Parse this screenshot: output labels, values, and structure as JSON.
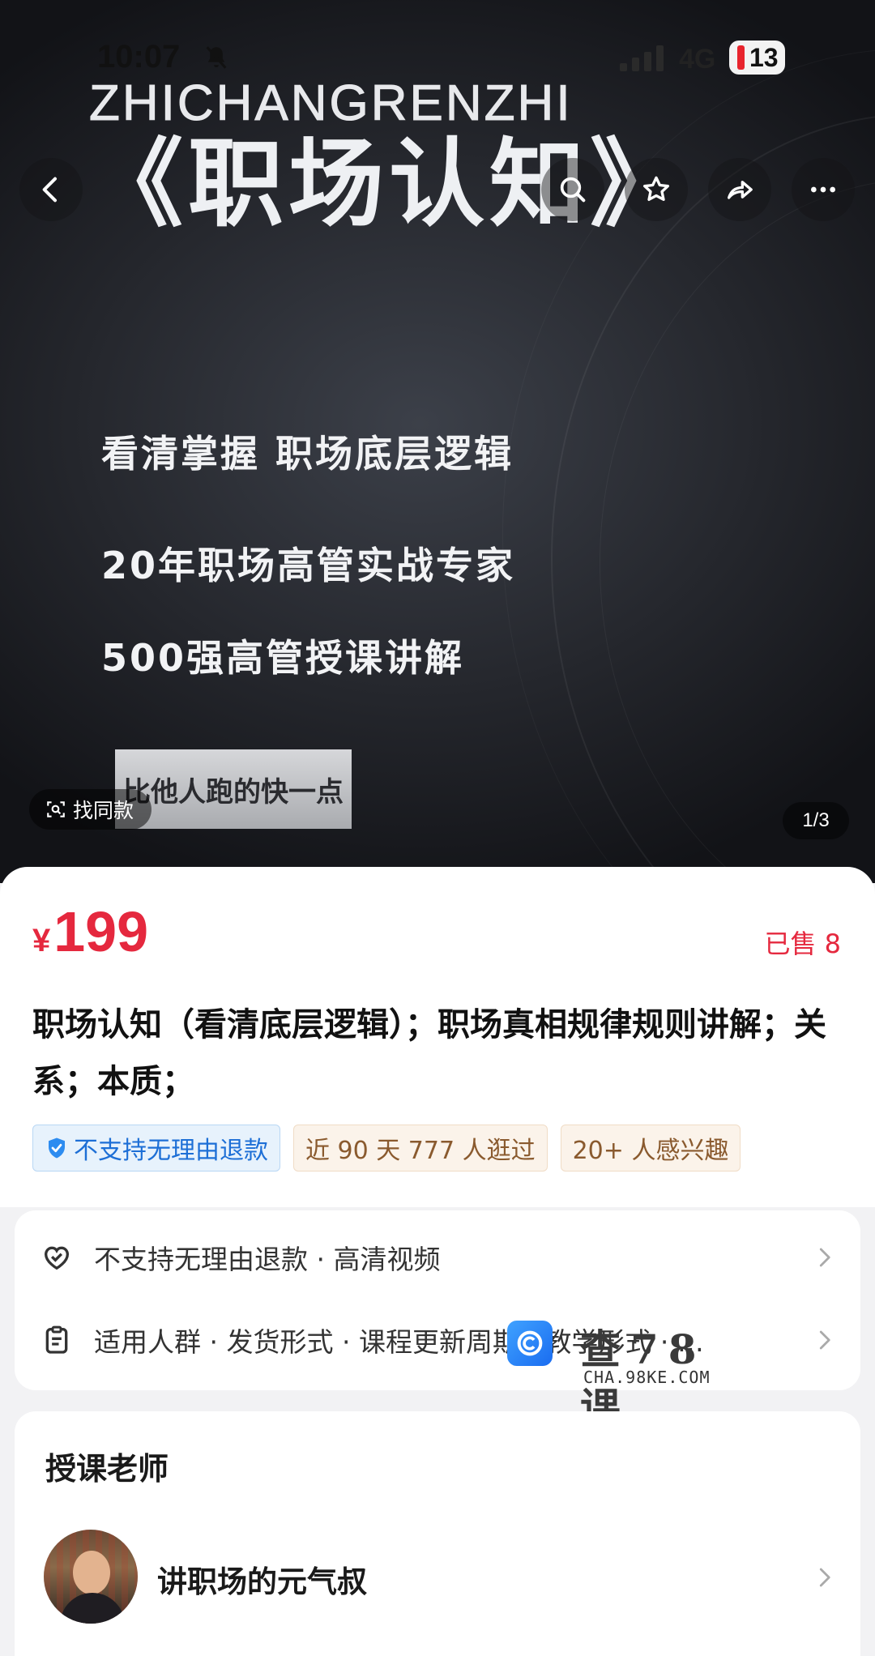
{
  "status_bar": {
    "time": "10:07",
    "network": "4G",
    "battery": "13"
  },
  "hero": {
    "subtitle_en": "ZHICHANGRENZHI",
    "title": "《职场认知》",
    "lines": [
      "看清掌握 职场底层逻辑",
      "20年职场高管实战专家",
      "500强高管授课讲解"
    ],
    "slogan": "比他人跑的快一点",
    "find_same_label": "找同款",
    "page_indicator": "1/3"
  },
  "product": {
    "currency": "¥",
    "price": "199",
    "sold": "已售 8",
    "title": "职场认知（看清底层逻辑）；职场真相规律规则讲解；关系；本质；",
    "tags": [
      "不支持无理由退款",
      "近 90 天 777 人逛过",
      "20+ 人感兴趣"
    ]
  },
  "service": {
    "row1": "不支持无理由退款 · 高清视频",
    "row2": "适用人群 · 发货形式 · 课程更新周期 · 教学形式 · …"
  },
  "watermark": {
    "text": "查78课",
    "sub": "CHA.98KE.COM"
  },
  "teacher": {
    "heading": "授课老师",
    "name": "讲职场的元气叔"
  },
  "colors": {
    "accent": "#e5283e",
    "tag_blue": "#1d6fd6",
    "tag_tan": "#8a5a2e"
  }
}
